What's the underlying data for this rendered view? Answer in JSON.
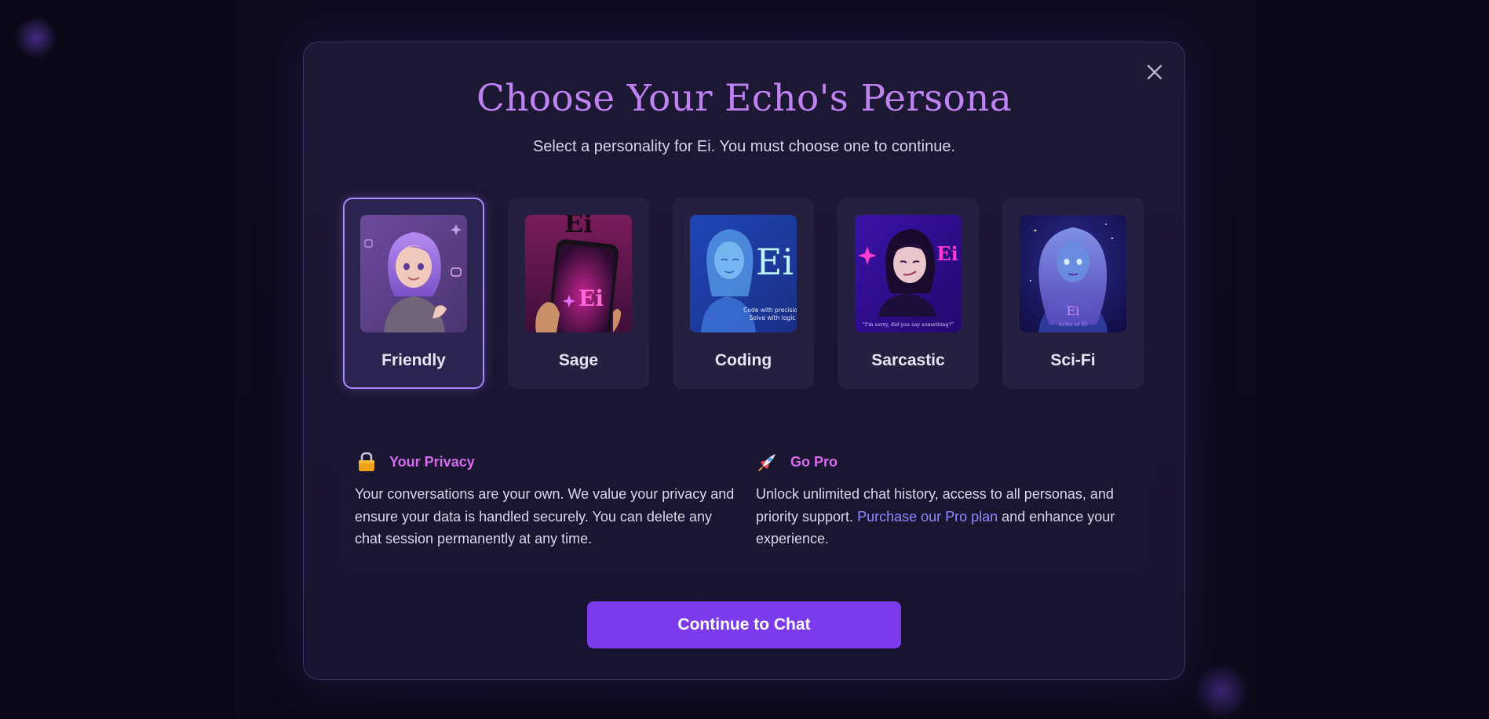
{
  "modal": {
    "title": "Choose Your Echo's Persona",
    "subtitle": "Select a personality for Ei. You must choose one to continue.",
    "close_icon": "close-icon"
  },
  "personas": [
    {
      "label": "Friendly",
      "selected": true,
      "art_text": ""
    },
    {
      "label": "Sage",
      "selected": false,
      "art_text": "Ei",
      "art_top_text": "Ei"
    },
    {
      "label": "Coding",
      "selected": false,
      "art_text": "Ei",
      "art_caption_1": "Code with precision",
      "art_caption_2": "Solve with logic"
    },
    {
      "label": "Sarcastic",
      "selected": false,
      "art_text": "Ei",
      "art_caption": "\"I'm sorry, did you say something?\""
    },
    {
      "label": "Sci-Fi",
      "selected": false,
      "art_text": "Ei",
      "art_caption": "Echo of Ei"
    }
  ],
  "info": {
    "privacy": {
      "icon": "lock-icon",
      "title": "Your Privacy",
      "body": "Your conversations are your own. We value your privacy and ensure your data is handled securely. You can delete any chat session permanently at any time."
    },
    "pro": {
      "icon": "rocket-icon",
      "title": "Go Pro",
      "body_before": "Unlock unlimited chat history, access to all personas, and priority support. ",
      "link": "Purchase our Pro plan",
      "body_after": " and enhance your experience."
    }
  },
  "cta": {
    "label": "Continue to Chat"
  },
  "colors": {
    "accent": "#7c3aed",
    "title": "#bf82f1",
    "info_title": "#d86cf0",
    "link": "#8f8bff",
    "selected_border": "#a88cff"
  }
}
